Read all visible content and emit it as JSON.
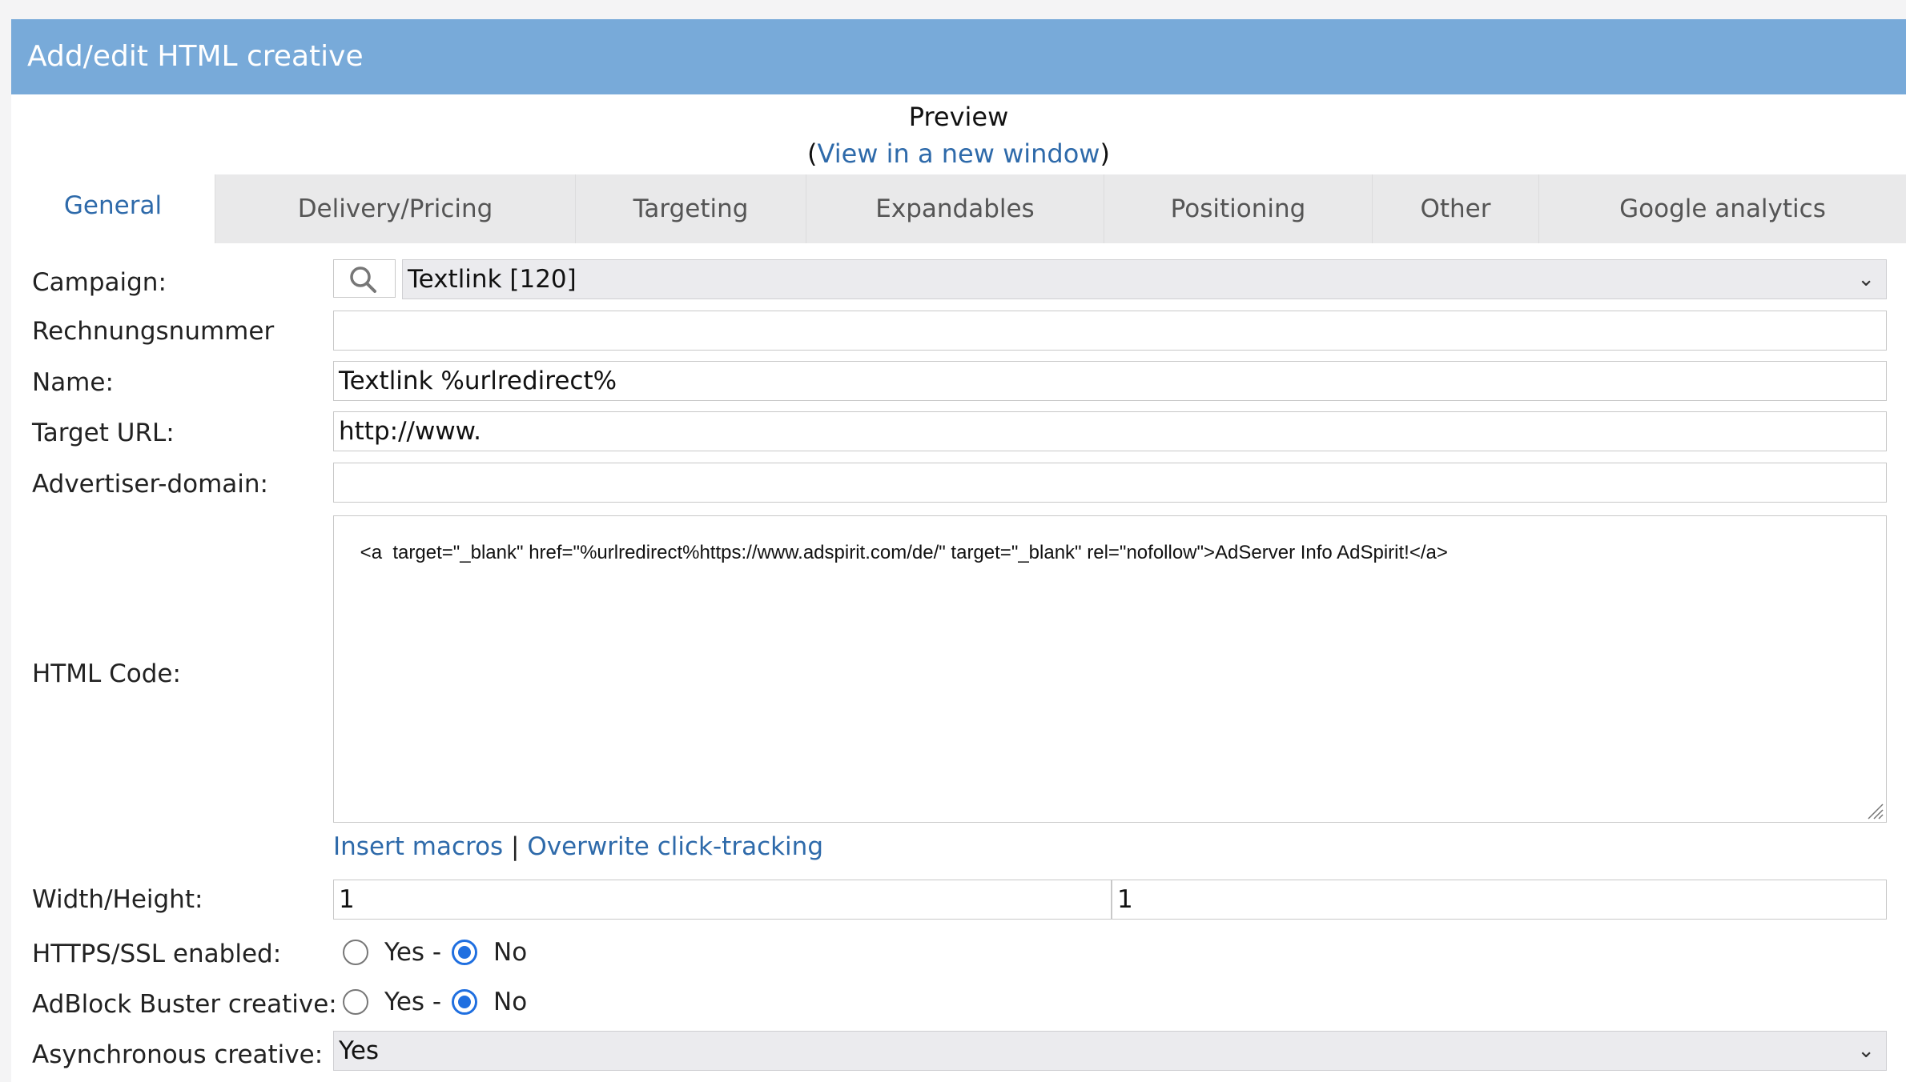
{
  "header": {
    "title": "Add/edit HTML creative"
  },
  "preview": {
    "label": "Preview",
    "open_paren": "(",
    "link": "View in a new window",
    "close_paren": ")"
  },
  "tabs": [
    {
      "label": "General",
      "active": true
    },
    {
      "label": "Delivery/Pricing"
    },
    {
      "label": "Targeting"
    },
    {
      "label": "Expandables"
    },
    {
      "label": "Positioning"
    },
    {
      "label": "Other"
    },
    {
      "label": "Google analytics"
    }
  ],
  "form": {
    "campaign": {
      "label": "Campaign:",
      "value": "Textlink [120]"
    },
    "invoice": {
      "label": "Rechnungsnummer",
      "value": ""
    },
    "name": {
      "label": "Name:",
      "value": "Textlink %urlredirect%"
    },
    "target_url": {
      "label": "Target URL:",
      "value": "http://www."
    },
    "advertiser_domain": {
      "label": "Advertiser-domain:",
      "value": ""
    },
    "html_code": {
      "label": "HTML Code:",
      "value": "<a  target=\"_blank\" href=\"%urlredirect%https://www.adspirit.com/de/\" target=\"_blank\" rel=\"nofollow\">AdServer Info AdSpirit!</a>"
    },
    "links": {
      "insert_macros": "Insert macros",
      "separator": "|",
      "overwrite_click_tracking": "Overwrite click-tracking"
    },
    "width_height": {
      "label": "Width/Height:",
      "width": "1",
      "height": "1"
    },
    "https": {
      "label": "HTTPS/SSL enabled:",
      "yes": "Yes -",
      "no": "No",
      "selected": "No"
    },
    "adblock": {
      "label": "AdBlock Buster creative:",
      "yes": "Yes -",
      "no": "No",
      "selected": "No"
    },
    "async": {
      "label": "Asynchronous creative:",
      "value": "Yes"
    }
  },
  "colors": {
    "header": "#78aad9",
    "link": "#2e6aaa",
    "radio": "#1f6fe0"
  }
}
